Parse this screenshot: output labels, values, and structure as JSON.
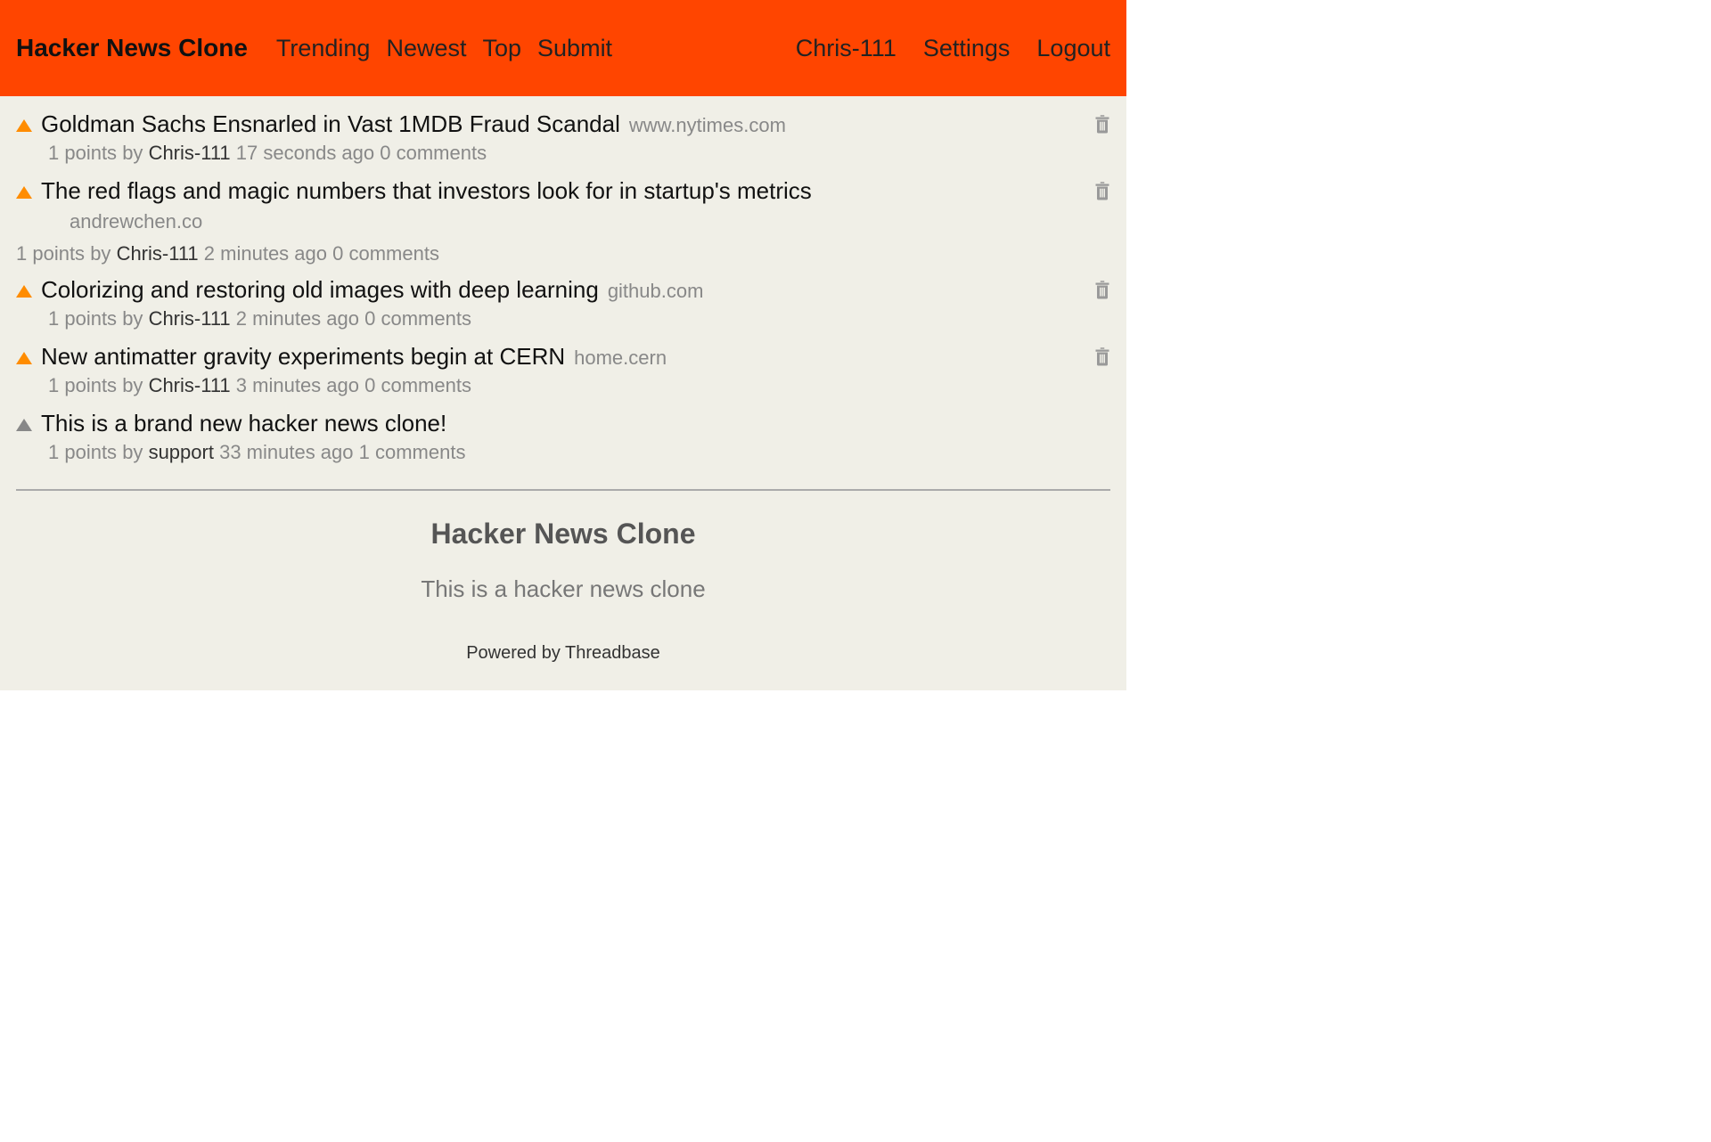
{
  "header": {
    "title": "Hacker News Clone",
    "nav_left": [
      "Trending",
      "Newest",
      "Top",
      "Submit"
    ],
    "nav_right": [
      "Chris-111",
      "Settings",
      "Logout"
    ]
  },
  "posts": [
    {
      "title": "Goldman Sachs Ensnarled in Vast 1MDB Fraud Scandal",
      "domain": "www.nytimes.com",
      "points": "1 points",
      "by": "by",
      "author": "Chris-111",
      "time": "17 seconds ago",
      "comments": "0 comments",
      "has_trash": true,
      "upvote_color": "orange",
      "domain_inline": true,
      "meta_indent": true
    },
    {
      "title": "The red flags and magic numbers that investors look for in startup's metrics",
      "domain": "andrewchen.co",
      "points": "1 points",
      "by": "by",
      "author": "Chris-111",
      "time": "2 minutes ago",
      "comments": "0 comments",
      "has_trash": true,
      "upvote_color": "orange",
      "domain_inline": false,
      "meta_indent": false
    },
    {
      "title": "Colorizing and restoring old images with deep learning",
      "domain": "github.com",
      "points": "1 points",
      "by": "by",
      "author": "Chris-111",
      "time": "2 minutes ago",
      "comments": "0 comments",
      "has_trash": true,
      "upvote_color": "orange",
      "domain_inline": true,
      "meta_indent": true
    },
    {
      "title": "New antimatter gravity experiments begin at CERN",
      "domain": "home.cern",
      "points": "1 points",
      "by": "by",
      "author": "Chris-111",
      "time": "3 minutes ago",
      "comments": "0 comments",
      "has_trash": true,
      "upvote_color": "orange",
      "domain_inline": true,
      "meta_indent": true
    },
    {
      "title": "This is a brand new hacker news clone!",
      "domain": "",
      "points": "1 points",
      "by": "by",
      "author": "support",
      "time": "33 minutes ago",
      "comments": "1 comments",
      "has_trash": false,
      "upvote_color": "gray",
      "domain_inline": true,
      "meta_indent": true
    }
  ],
  "footer": {
    "title": "Hacker News Clone",
    "sub": "This is a hacker news clone",
    "powered": "Powered by Threadbase"
  }
}
